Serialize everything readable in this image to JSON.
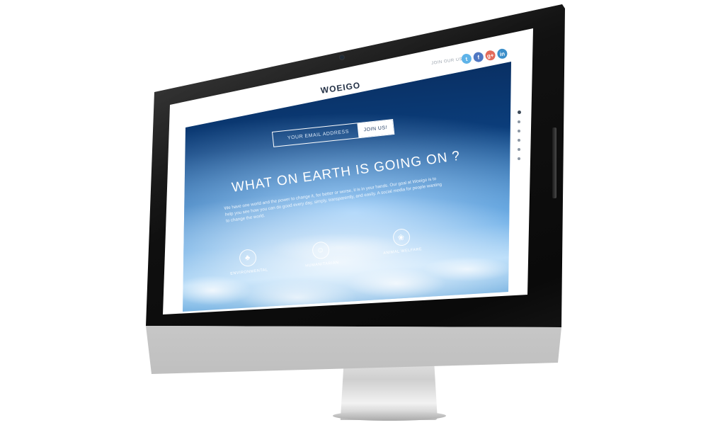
{
  "site": {
    "logo": "WOEIGO"
  },
  "social": {
    "label": "JOIN OUR US",
    "items": [
      {
        "name": "twitter",
        "glyph": "t",
        "color": "#5eb3e8"
      },
      {
        "name": "facebook",
        "glyph": "f",
        "color": "#4f77c2"
      },
      {
        "name": "google-plus",
        "glyph": "g+",
        "color": "#e36a5a"
      },
      {
        "name": "linkedin",
        "glyph": "in",
        "color": "#3b8ec9"
      }
    ]
  },
  "signup": {
    "placeholder": "YOUR EMAIL ADDRESS",
    "button": "JOIN US!"
  },
  "hero": {
    "headline": "WHAT ON EARTH IS GOING ON ?",
    "subtext": "We have one world and the power to change it, for better or worse, it is in your hands. Our goal at Woeigo is to help you see how you can do good every day, simply, transparently, and easily. A social media for people wanting to change the world."
  },
  "categories": [
    {
      "label": "ENVIRONMENTAL",
      "icon": "tree-icon",
      "glyph": "♣"
    },
    {
      "label": "HUMANITARIAN",
      "icon": "person-icon",
      "glyph": "☺"
    },
    {
      "label": "ANIMAL WELFARE",
      "icon": "paw-icon",
      "glyph": "❀"
    }
  ],
  "pager": {
    "count": 6,
    "active_index": 0
  },
  "colors": {
    "accent": "#16335c",
    "text_light": "#ffffff"
  }
}
